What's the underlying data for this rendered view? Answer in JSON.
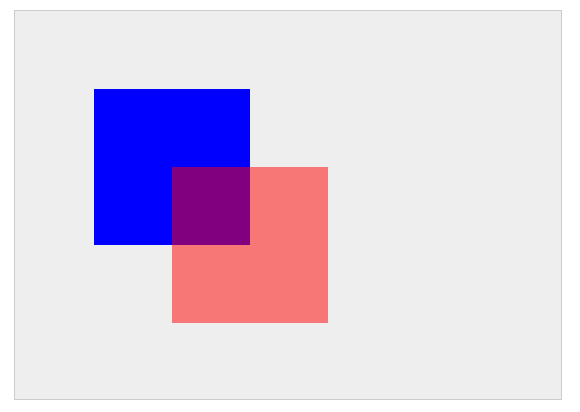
{
  "canvas": {
    "background": "#eeeeee",
    "border_color": "#cccccc"
  },
  "shapes": [
    {
      "name": "blue-square",
      "color": "#0000ff",
      "opacity": 1.0
    },
    {
      "name": "red-translucent-square",
      "color": "#ff0000",
      "opacity": 0.5
    }
  ]
}
